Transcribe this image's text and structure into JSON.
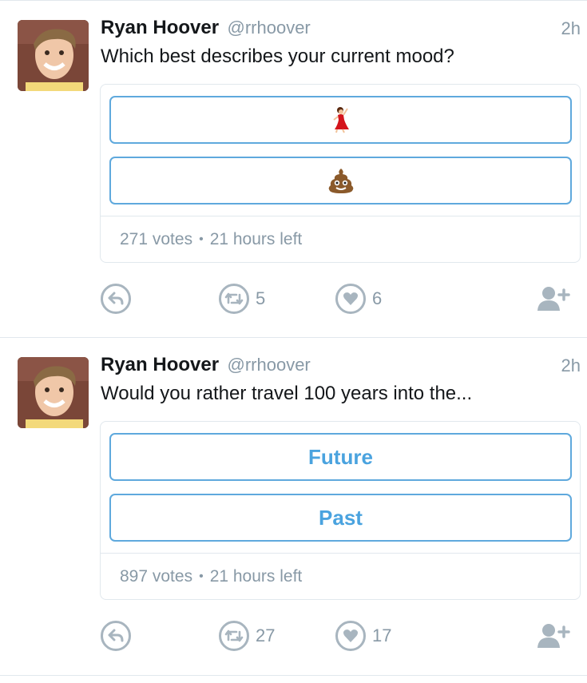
{
  "tweets": [
    {
      "author_name": "Ryan Hoover",
      "author_handle": "@rrhoover",
      "time": "2h",
      "text": "Which best describes your current mood?",
      "poll": {
        "options": [
          {
            "label": "",
            "icon": "dancing-woman-emoji"
          },
          {
            "label": "",
            "icon": "pile-of-poo-emoji"
          }
        ],
        "votes": "271 votes",
        "time_left": "21 hours left"
      },
      "actions": {
        "retweets": "5",
        "likes": "6"
      }
    },
    {
      "author_name": "Ryan Hoover",
      "author_handle": "@rrhoover",
      "time": "2h",
      "text": "Would you rather travel 100 years into the...",
      "poll": {
        "options": [
          {
            "label": "Future"
          },
          {
            "label": "Past"
          }
        ],
        "votes": "897 votes",
        "time_left": "21 hours left"
      },
      "actions": {
        "retweets": "27",
        "likes": "17"
      }
    }
  ],
  "colors": {
    "accent": "#4aa3df",
    "muted": "#8899a6",
    "border": "#e1e8ed",
    "icon": "#a8b5bf"
  },
  "footer_separator": "•"
}
